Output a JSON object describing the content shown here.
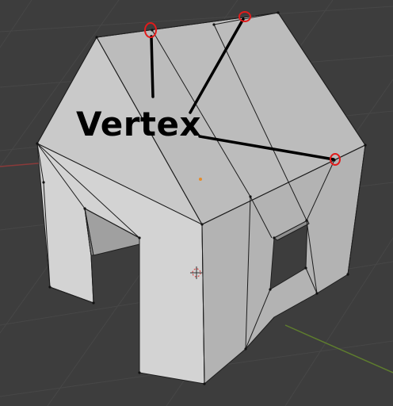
{
  "annotation": {
    "label": "Vertex"
  },
  "colors": {
    "viewport_background": "#3d3d3d",
    "grid_line": "#474747",
    "grid_axis_x": "#8a3a3a",
    "grid_axis_y": "#5e7d2e",
    "mesh_face_light": "#c8c8c8",
    "mesh_face_side": "#b1b1b1",
    "mesh_face_shadow": "#9a9a9a",
    "mesh_edge": "#1e1e1e",
    "vertex_marker_circle": "#e21b1b",
    "annotation_text": "#000000"
  },
  "icons": [
    "3d-cursor-icon",
    "object-origin-icon"
  ]
}
